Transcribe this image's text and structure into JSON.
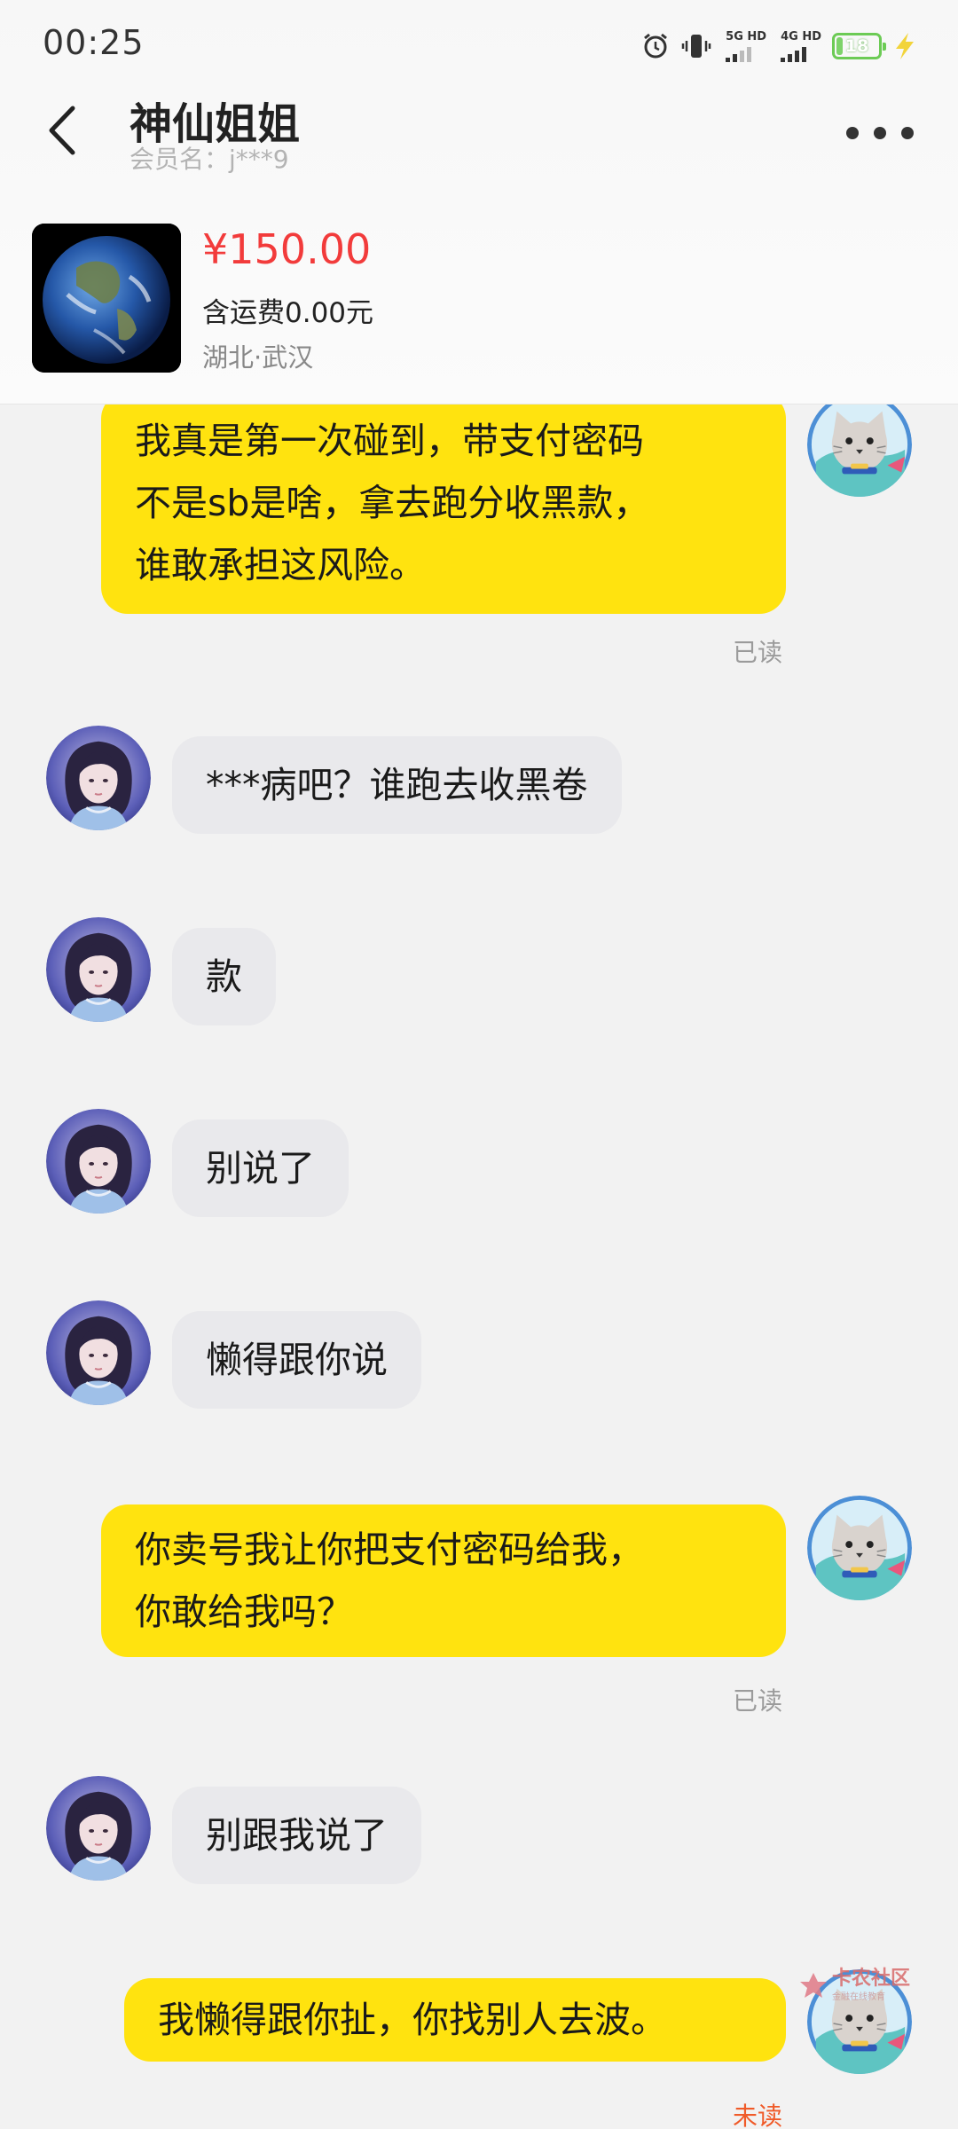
{
  "status_bar": {
    "time": "00:25",
    "net1_label": "5G HD",
    "net2_label": "4G HD",
    "battery_level": "18"
  },
  "header": {
    "title": "神仙姐姐",
    "member_label": "会员名：j***9"
  },
  "product": {
    "price": "¥150.00",
    "shipping": "含运费0.00元",
    "location": "湖北·武汉"
  },
  "messages": [
    {
      "from": "me",
      "lines": [
        "我真是第一次碰到，带支付密码",
        "不是sb是啥，拿去跑分收黑款，",
        "谁敢承担这风险。"
      ],
      "receipt": "已读"
    },
    {
      "from": "them",
      "text": "***病吧？谁跑去收黑卷"
    },
    {
      "from": "them",
      "text": "款"
    },
    {
      "from": "them",
      "text": "别说了"
    },
    {
      "from": "them",
      "text": "懒得跟你说"
    },
    {
      "from": "me",
      "lines": [
        "你卖号我让你把支付密码给我，",
        "你敢给我吗？"
      ],
      "receipt": "已读"
    },
    {
      "from": "them",
      "text": "别跟我说了"
    },
    {
      "from": "me",
      "lines": [
        "我懒得跟你扯，你找别人去波。"
      ],
      "receipt": "未读"
    }
  ],
  "watermark": {
    "text": "卡农社区",
    "sub": "金融在线教育"
  },
  "colors": {
    "my_bubble": "#ffe30f",
    "their_bubble": "#e9e9ec",
    "price": "#f23b3b",
    "unread": "#f05a28"
  }
}
